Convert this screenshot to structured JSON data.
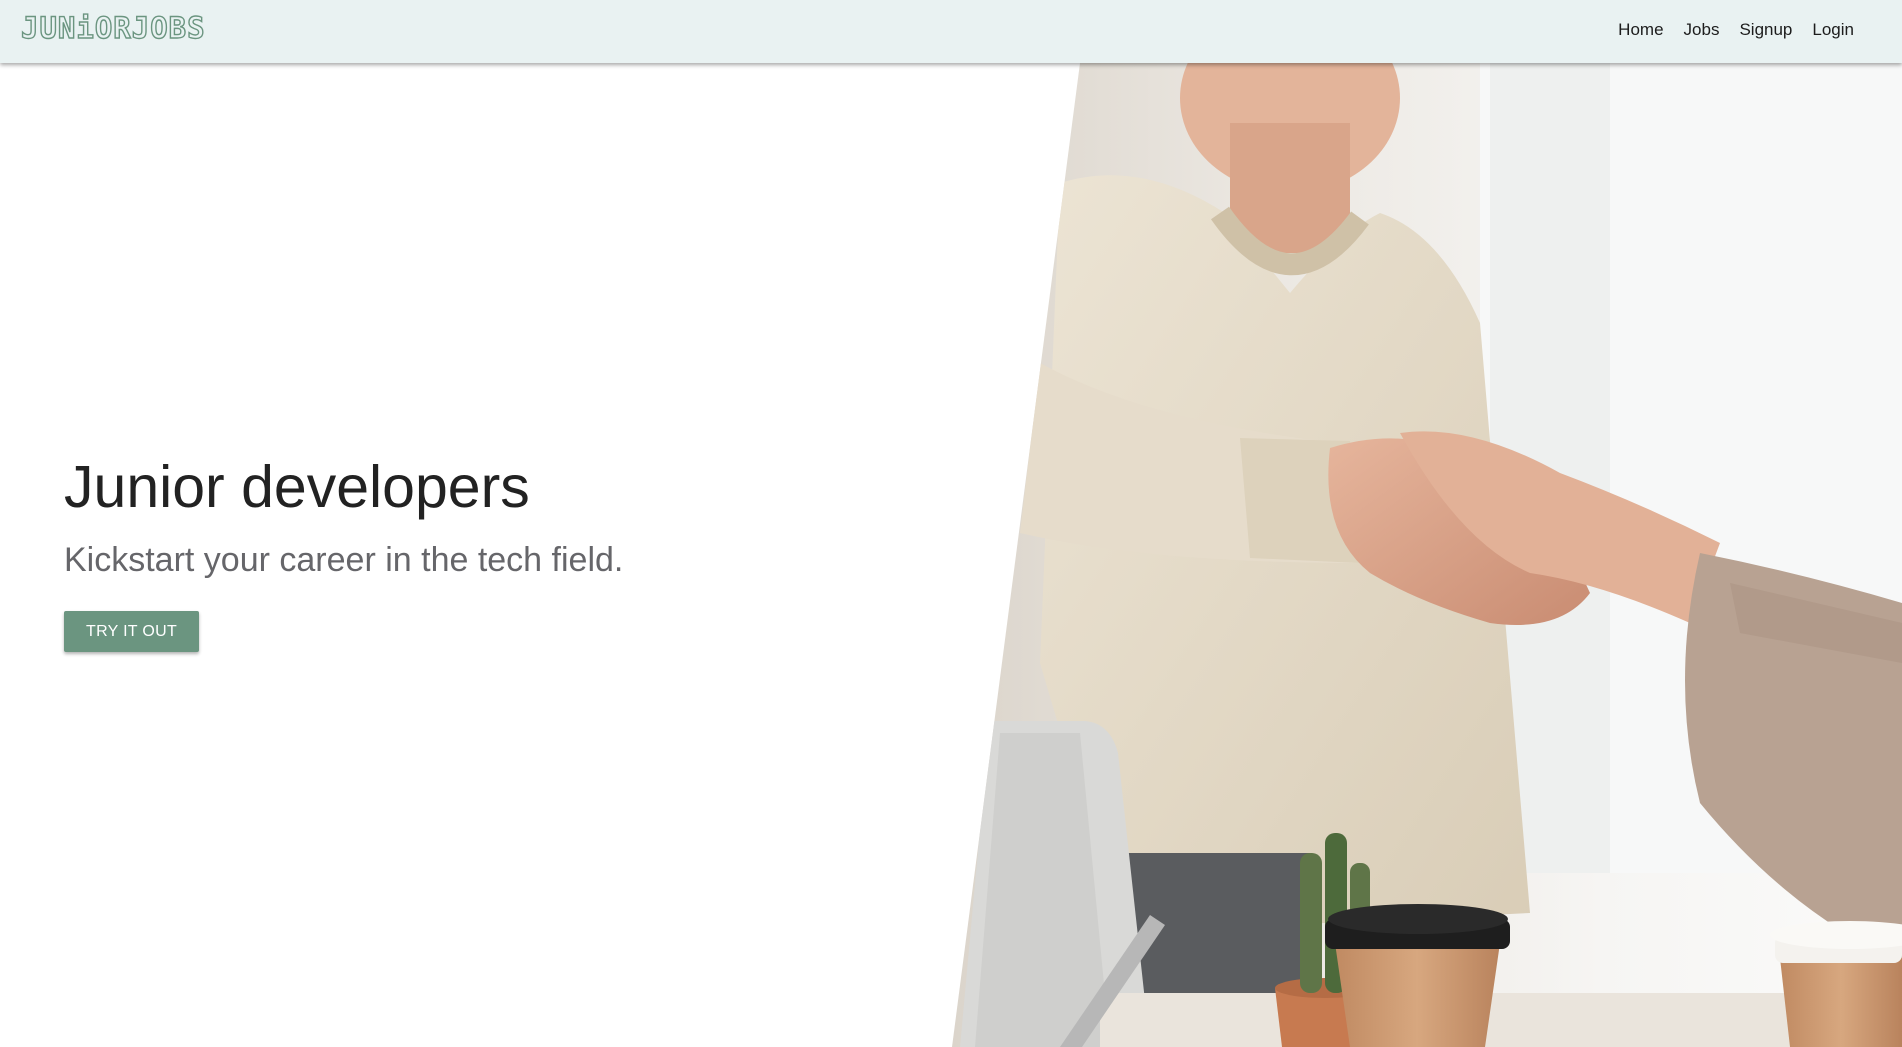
{
  "brand": {
    "logo_text": "JUNiORJOBS",
    "accent_color": "#6b9580",
    "navbar_color": "#e9f2f2"
  },
  "nav": {
    "items": [
      {
        "label": "Home"
      },
      {
        "label": "Jobs"
      },
      {
        "label": "Signup"
      },
      {
        "label": "Login"
      }
    ]
  },
  "hero": {
    "title": "Junior developers",
    "subtitle": "Kickstart your career in the tech field.",
    "cta_label": "TRY IT OUT",
    "image_subject": "handshake-photo"
  }
}
